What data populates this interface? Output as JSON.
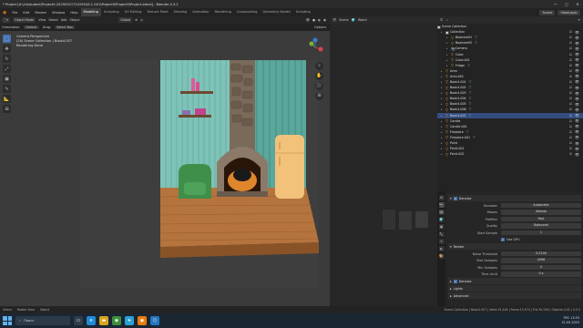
{
  "title": "* Project [A:\\ch\\student\\Project9-20250521T102954Z-1-001\\Project9\\Project9\\Project.blend] - Blender 4.3.2",
  "window_controls": [
    "—",
    "▢",
    "✕"
  ],
  "menu": [
    "File",
    "Edit",
    "Render",
    "Window",
    "Help"
  ],
  "workspaces": [
    "Modeling",
    "Sculpting",
    "UV Editing",
    "Texture Paint",
    "Shading",
    "Animation",
    "Rendering",
    "Compositing",
    "Geometry Nodes",
    "Scripting"
  ],
  "active_workspace": "Modeling",
  "scene_name": "Scene",
  "view_layer": "ViewLayer",
  "viewport": {
    "mode": "Object Mode",
    "menus": [
      "View",
      "Select",
      "Add",
      "Object"
    ],
    "transform": "Global",
    "orientation_label": "Orientation:",
    "orientation_value": "Default",
    "drag_label": "Drag:",
    "drag_value": "Select Box",
    "options": "Options",
    "info_line1": "Camera Perspective",
    "info_line2": "(20) Scene Collection | Book4.007",
    "info_line3": "Rendering Done",
    "toolbar_icons": [
      "⬚",
      "✥",
      "↻",
      "⤢",
      "▣",
      "✎",
      "📐",
      "⊞"
    ]
  },
  "middle_panel": {
    "items": [
      "Scene",
      "World"
    ]
  },
  "outliner": {
    "header": "Scene Collection",
    "rows": [
      {
        "indent": 0,
        "icon": "collection",
        "label": "Collection",
        "extra": "",
        "sel": false
      },
      {
        "indent": 1,
        "icon": "obj",
        "label": "Bookshelf1",
        "extra": "▽",
        "sel": false
      },
      {
        "indent": 1,
        "icon": "obj",
        "label": "Bookshelf2",
        "extra": "▽",
        "sel": false
      },
      {
        "indent": 1,
        "icon": "camera",
        "label": "Camera",
        "extra": "",
        "sel": false
      },
      {
        "indent": 1,
        "icon": "obj",
        "label": "Cube",
        "extra": "",
        "sel": false
      },
      {
        "indent": 1,
        "icon": "obj",
        "label": "Cube.001",
        "extra": "",
        "sel": false
      },
      {
        "indent": 1,
        "icon": "obj",
        "label": "Fridge",
        "extra": "▽",
        "sel": false
      },
      {
        "indent": 0,
        "icon": "obj",
        "label": "Area",
        "extra": "",
        "sel": false
      },
      {
        "indent": 0,
        "icon": "obj",
        "label": "Area.001",
        "extra": "",
        "sel": false
      },
      {
        "indent": 0,
        "icon": "obj",
        "label": "Book4.001",
        "extra": "▽",
        "sel": false
      },
      {
        "indent": 0,
        "icon": "obj",
        "label": "Book4.002",
        "extra": "▽",
        "sel": false
      },
      {
        "indent": 0,
        "icon": "obj",
        "label": "Book4.003",
        "extra": "▽",
        "sel": false
      },
      {
        "indent": 0,
        "icon": "obj",
        "label": "Book4.004",
        "extra": "▽",
        "sel": false
      },
      {
        "indent": 0,
        "icon": "obj",
        "label": "Book4.005",
        "extra": "▽",
        "sel": false
      },
      {
        "indent": 0,
        "icon": "obj",
        "label": "Book4.006",
        "extra": "▽",
        "sel": false
      },
      {
        "indent": 0,
        "icon": "obj",
        "label": "Book4.007",
        "extra": "▽",
        "sel": true
      },
      {
        "indent": 0,
        "icon": "obj",
        "label": "Candle",
        "extra": "",
        "sel": false
      },
      {
        "indent": 0,
        "icon": "obj",
        "label": "Candle.001",
        "extra": "",
        "sel": false
      },
      {
        "indent": 0,
        "icon": "obj",
        "label": "Fireplace",
        "extra": "▽",
        "sel": false
      },
      {
        "indent": 0,
        "icon": "obj",
        "label": "Fireplace.001",
        "extra": "▽",
        "sel": false
      },
      {
        "indent": 0,
        "icon": "obj",
        "label": "Point",
        "extra": "",
        "sel": false
      },
      {
        "indent": 0,
        "icon": "obj",
        "label": "Point.001",
        "extra": "",
        "sel": false
      },
      {
        "indent": 0,
        "icon": "obj",
        "label": "Point.002",
        "extra": "",
        "sel": false
      }
    ]
  },
  "properties": {
    "section_denoise": "Denoise",
    "rows1": [
      {
        "label": "Denoiser",
        "value": "Automatic"
      },
      {
        "label": "Passes",
        "value": "Albedo"
      },
      {
        "label": "Prefilter",
        "value": "Fast"
      },
      {
        "label": "Quality",
        "value": "Balanced"
      },
      {
        "label": "Start Sample",
        "value": "1"
      }
    ],
    "use_gpu": "Use GPU",
    "section_render": "Render",
    "rows2": [
      {
        "label": "Noise Threshold",
        "value": "0.0100"
      },
      {
        "label": "Max Samples",
        "value": "4096"
      },
      {
        "label": "Min Samples",
        "value": "0"
      },
      {
        "label": "Time Limit",
        "value": "0 s"
      }
    ],
    "section_denoise2": "Denoise",
    "section_lights": "Lights",
    "section_advanced": "Advanced",
    "tab_icons": [
      "⚙",
      "📷",
      "🖼",
      "🌍",
      "▣",
      "🔧",
      "⚛",
      "◐",
      "🎨"
    ]
  },
  "status": {
    "left": [
      "Select",
      "Rotate View",
      "Object"
    ],
    "right": "Scene Collection | Book4.007 | Verts:15,446 | Faces:15,974 | Tris:30,526 | Objects:1/42 | 4.3.2"
  },
  "taskbar": {
    "search": "Поиск",
    "time": "13:53",
    "date": "21.05.2025",
    "lang": "РУС"
  },
  "colors": {
    "wall_left": "#7fc3b8",
    "wall_right": "#5aa79c",
    "floor": "#b5743e",
    "chimney": "#7a6a5a",
    "armchair": "#3f8f4a",
    "fridge": "#f2c27a",
    "fire": "#ff9a32",
    "selection": "#334d80",
    "accent": "#4772b3"
  }
}
